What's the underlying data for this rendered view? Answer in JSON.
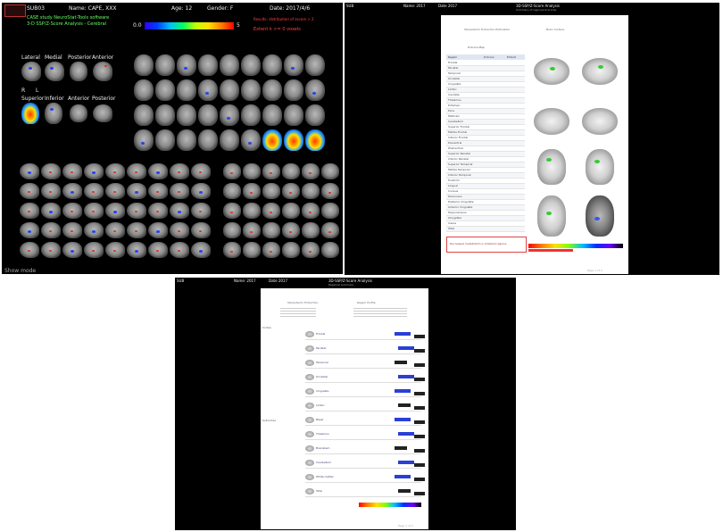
{
  "panel1": {
    "header_left": "SUB03",
    "header_name": "Name: CAPE, XXX",
    "header_age": "Age: 12",
    "header_gender": "Gender: F",
    "header_date": "Date: 2017/4/6",
    "sub_line1": "CASE study NeuroStat-Tools software",
    "sub_line2": "3-D SSP/Z-Score Analysis - Cerebral",
    "red_line1": "Results: distribution of zscore > 2",
    "red_line2": "Extent k >= 0 voxels",
    "scale_min": "0.0",
    "scale_max": "5",
    "views": [
      "Lateral",
      "Medial",
      "Posterior",
      "Anterior"
    ],
    "views2": [
      "Superior",
      "Inferior",
      "Anterior",
      "Posterior"
    ],
    "side_labels": [
      "R",
      "L",
      "R",
      "L"
    ],
    "footer": "Show mode"
  },
  "panel2": {
    "header_left": "SUB",
    "header_mid1": "Name: 2017",
    "header_mid2": "Date 2017",
    "header_title": "3D-SSP/Z-Score Analysis",
    "header_sub": "Summary of regional Z-scores",
    "page_left_title": "Stereotactic Extraction Estimation",
    "page_right_title": "Brain Surface",
    "section_label": "Z-Score Map",
    "table_header": [
      "Region",
      "Z-Score",
      "Extent"
    ],
    "rows": [
      "Frontal",
      "Parietal",
      "Temporal",
      "Occipital",
      "Cingulate",
      "Limbic",
      "Caudate",
      "Thalamus",
      "Putamen",
      "Pons",
      "Midbrain",
      "Cerebellum",
      "Superior Frontal",
      "Middle Frontal",
      "Inferior Frontal",
      "Precentral",
      "Postcentral",
      "Superior Parietal",
      "Inferior Parietal",
      "Superior Temporal",
      "Middle Temporal",
      "Inferior Temporal",
      "Fusiform",
      "Lingual",
      "Cuneus",
      "Precuneus",
      "Posterior Cingulate",
      "Anterior Cingulate",
      "Hippocampus",
      "Amygdala",
      "Insula",
      "Total"
    ],
    "note": "Decreased metabolism in bilateral regions",
    "footer": "Page 1 of 2"
  },
  "panel3": {
    "header_left": "SUB",
    "header_mid1": "Name: 2017",
    "header_mid2": "Date 2017",
    "header_title": "3D-SSP/Z-Score Analysis",
    "header_sub": "Regional summary",
    "page_title_left": "Stereotactic Extraction",
    "page_title_right": "Region Profile",
    "side_label_top": "Cortex",
    "side_label_bottom": "Subcortex",
    "groups": [
      "Frontal",
      "Parietal",
      "Temporal",
      "Occipital",
      "Cingulate",
      "Limbic",
      "Basal",
      "Thalamus",
      "Brainstem",
      "Cerebellum",
      "White matter",
      "Total"
    ],
    "footer": "Page 2 of 2"
  },
  "colors": {
    "accent_red": "#ff4444",
    "accent_green": "#66ff66",
    "panel_bg": "#000000"
  }
}
